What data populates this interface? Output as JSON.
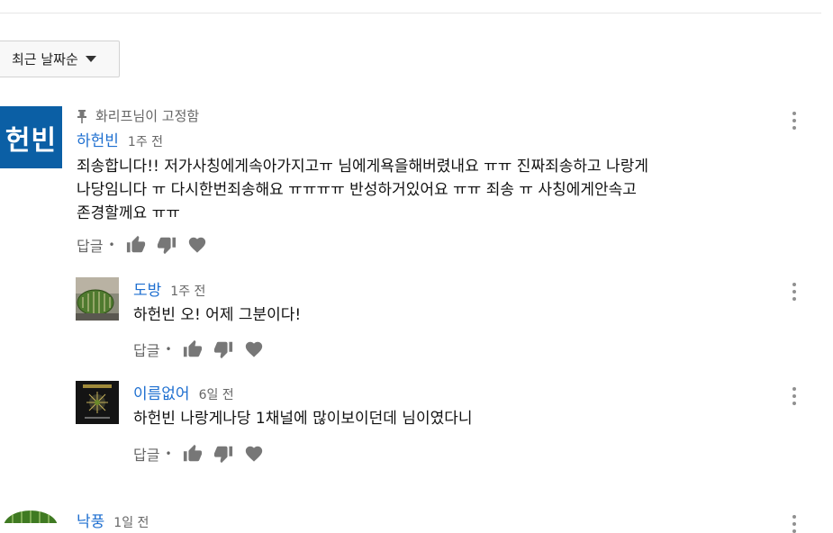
{
  "sort": {
    "label": "최근 날짜순"
  },
  "main_comment": {
    "avatar_text": "헌빈",
    "pinned_label": "화리프님이 고정함",
    "author": "하헌빈",
    "time": "1주 전",
    "lines": [
      "죄송합니다!! 저가사칭에게속아가지고ㅠ 님에게욕을해버렸내요 ㅠㅠ 진짜죄송하고 나랑게",
      "나당임니다 ㅠ 다시한번죄송해요 ㅠㅠㅠㅠ 반성하거있어요 ㅠㅠ 죄송 ㅠ 사칭에게안속고",
      "존경할께요 ㅠㅠ"
    ],
    "reply_label": "답글",
    "dot": "•"
  },
  "replies": [
    {
      "author": "도방",
      "time": "1주 전",
      "text": "하헌빈 오! 어제 그분이다!",
      "reply_label": "답글",
      "dot": "•"
    },
    {
      "author": "이름없어",
      "time": "6일 전",
      "text": "하헌빈 나랑게나당 1채널에 많이보이던데 님이였다니",
      "reply_label": "답글",
      "dot": "•"
    }
  ],
  "next_comment": {
    "author": "낙풍",
    "time": "1일 전"
  },
  "icons": {
    "pin": "pin-icon",
    "like": "thumbs-up-icon",
    "dislike": "thumbs-down-icon",
    "heart": "heart-icon",
    "menu": "more-vertical-icon",
    "sort_caret": "caret-down-icon"
  },
  "colors": {
    "author_link": "#1e6fd0",
    "avatar_bg": "#0b5fa5",
    "muted": "#666666"
  }
}
